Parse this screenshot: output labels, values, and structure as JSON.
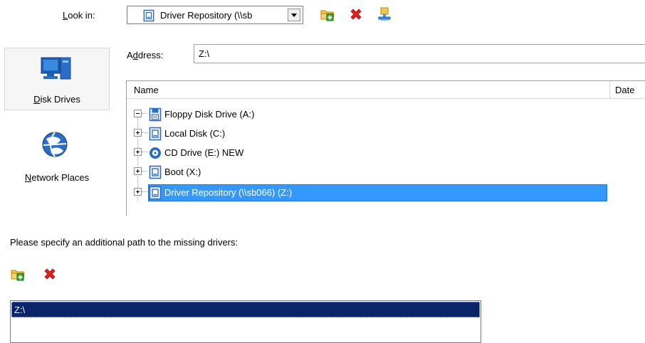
{
  "look_in": {
    "label": "Look in:",
    "value": "Driver Repository (\\\\sb",
    "toolbar": [
      "new-folder-icon",
      "delete-icon",
      "network-drive-icon"
    ]
  },
  "nav": {
    "disk_drives": "Disk Drives",
    "network_places": "Network Places"
  },
  "address": {
    "label": "Address:",
    "value": "Z:\\"
  },
  "tree": {
    "columns": [
      "Name",
      "Date"
    ],
    "items": [
      {
        "label": "Floppy Disk Drive (A:)",
        "icon": "floppy-icon",
        "expanded": true,
        "selected": false
      },
      {
        "label": "Local Disk (C:)",
        "icon": "drive-icon",
        "expanded": false,
        "selected": false
      },
      {
        "label": "CD Drive (E:) NEW",
        "icon": "cd-icon",
        "expanded": false,
        "selected": false
      },
      {
        "label": "Boot (X:)",
        "icon": "drive-icon",
        "expanded": false,
        "selected": false
      },
      {
        "label": "Driver Repository (\\\\sb066) (Z:)",
        "icon": "drive-icon",
        "expanded": false,
        "selected": true
      }
    ]
  },
  "driver_paths": {
    "prompt": "Please specify an additional path to the missing drivers:",
    "toolbar": [
      "add-folder-icon",
      "delete-icon"
    ],
    "items": [
      "Z:\\"
    ]
  },
  "colors": {
    "tree_selection": "#3399ff",
    "list_selection": "#0a246a",
    "delete_red": "#e02020",
    "folder_yellow": "#f2c84b",
    "plus_green": "#2fa52f"
  }
}
